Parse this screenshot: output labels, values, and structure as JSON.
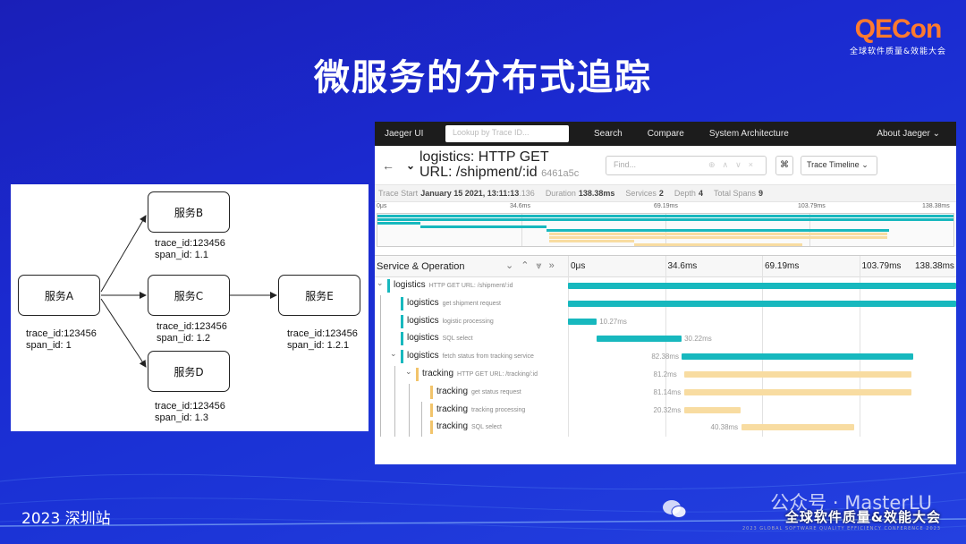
{
  "slide": {
    "title": "微服务的分布式追踪",
    "logo_main": "QECon",
    "logo_sub": "全球软件质量&效能大会",
    "footer_left": "2023 深圳站",
    "watermark": "公众号 · MasterLU",
    "conf_name": "全球软件质量&效能大会",
    "conf_sub": "2023 GLOBAL SOFTWARE QUALITY EFFICIENCY CONFERENCE 2023"
  },
  "diagram": {
    "services": {
      "a": "服务A",
      "b": "服务B",
      "c": "服务C",
      "d": "服务D",
      "e": "服务E"
    },
    "info": {
      "a": [
        "trace_id:123456",
        "span_id: 1"
      ],
      "b": [
        "trace_id:123456",
        "span_id: 1.1"
      ],
      "c": [
        "trace_id:123456",
        "span_id: 1.2"
      ],
      "d": [
        "trace_id:123456",
        "span_id: 1.3"
      ],
      "e": [
        "trace_id:123456",
        "span_id: 1.2.1"
      ]
    }
  },
  "jaeger": {
    "nav": {
      "brand": "Jaeger UI",
      "lookup_placeholder": "Lookup by Trace ID...",
      "search": "Search",
      "compare": "Compare",
      "system_architecture": "System Architecture",
      "about": "About Jaeger"
    },
    "header": {
      "title_line1": "logistics: HTTP GET",
      "title_line2": "URL: /shipment/:id",
      "trace_id": "6461a5c",
      "find_placeholder": "Find...",
      "view_select": "Trace Timeline"
    },
    "stats": {
      "trace_start_label": "Trace Start",
      "trace_start": "January 15 2021, 13:11:13",
      "trace_start_ms": ".136",
      "duration_label": "Duration",
      "duration": "138.38ms",
      "services_label": "Services",
      "services": "2",
      "depth_label": "Depth",
      "depth": "4",
      "total_spans_label": "Total Spans",
      "total_spans": "9"
    },
    "ticks": [
      "0μs",
      "34.6ms",
      "69.19ms",
      "103.79ms",
      "138.38ms"
    ],
    "column_header": "Service & Operation",
    "colors": {
      "logistics": "#17b8be",
      "tracking": "#f8dca1"
    }
  },
  "chart_data": {
    "type": "gantt",
    "x_unit": "ms",
    "xlim": [
      0,
      138.38
    ],
    "spans": [
      {
        "service": "logistics",
        "operation": "HTTP GET URL: /shipment/:id",
        "depth": 0,
        "start": 0,
        "duration": 138.38,
        "label": ""
      },
      {
        "service": "logistics",
        "operation": "get shipment request",
        "depth": 1,
        "start": 0,
        "duration": 138.38,
        "label": ""
      },
      {
        "service": "logistics",
        "operation": "logistic processing",
        "depth": 1,
        "start": 0,
        "duration": 10.27,
        "label": "10.27ms"
      },
      {
        "service": "logistics",
        "operation": "SQL select",
        "depth": 1,
        "start": 10.3,
        "duration": 30.22,
        "label": "30.22ms"
      },
      {
        "service": "logistics",
        "operation": "fetch status from tracking service",
        "depth": 1,
        "start": 40.6,
        "duration": 82.38,
        "label": "82.38ms"
      },
      {
        "service": "tracking",
        "operation": "HTTP GET URL: /tracking/:id",
        "depth": 2,
        "start": 41.3,
        "duration": 81.2,
        "label": "81.2ms"
      },
      {
        "service": "tracking",
        "operation": "get status request",
        "depth": 3,
        "start": 41.3,
        "duration": 81.14,
        "label": "81.14ms"
      },
      {
        "service": "tracking",
        "operation": "tracking processing",
        "depth": 3,
        "start": 41.3,
        "duration": 20.32,
        "label": "20.32ms"
      },
      {
        "service": "tracking",
        "operation": "SQL select",
        "depth": 3,
        "start": 61.7,
        "duration": 40.38,
        "label": "40.38ms"
      }
    ]
  }
}
